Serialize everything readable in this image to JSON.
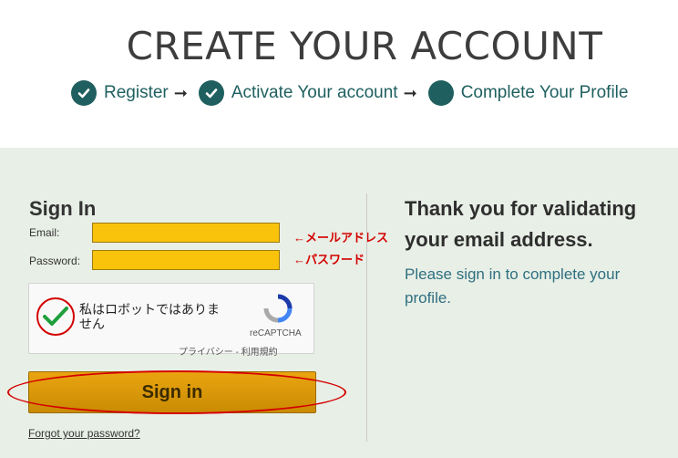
{
  "header": {
    "title": "CREATE YOUR ACCOUNT",
    "steps": [
      {
        "label": "Register",
        "state": "done"
      },
      {
        "label": "Activate Your account",
        "state": "done"
      },
      {
        "label": "Complete Your Profile",
        "state": "current"
      }
    ],
    "arrow": "➞"
  },
  "signin": {
    "title": "Sign In",
    "email_label": "Email:",
    "password_label": "Password:",
    "email_value": "",
    "password_value": "",
    "email_note": "←メールアドレス",
    "password_note": "←パスワード",
    "captcha": {
      "text": "私はロボットではありません",
      "brand": "reCAPTCHA",
      "links": "プライバシー - 利用規約",
      "checked": true
    },
    "button_label": "Sign in",
    "forgot_label": "Forgot your password?"
  },
  "message": {
    "heading": "Thank you for validating your email address.",
    "body": "Please sign in to complete your profile."
  },
  "colors": {
    "accent": "#1f5f5f",
    "panel_bg": "#e8efe6",
    "input_highlight": "#f8c30a",
    "annotation": "#d40000",
    "button": "#d99806"
  }
}
